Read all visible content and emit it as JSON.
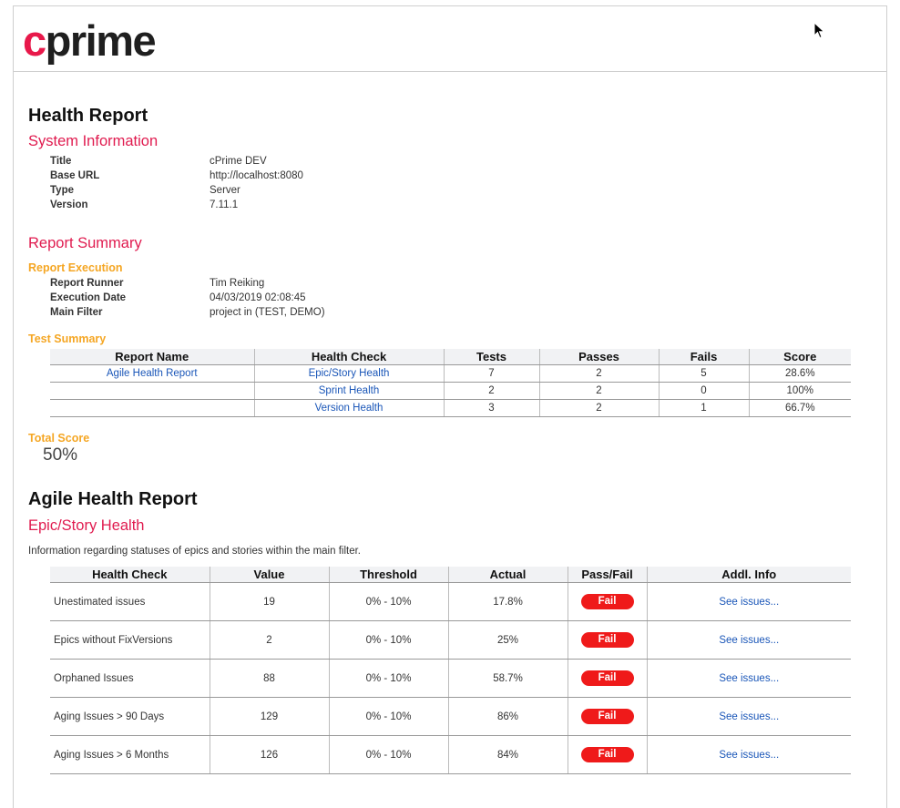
{
  "logo": {
    "first": "c",
    "rest": "prime"
  },
  "health_report_title": "Health Report",
  "system_info": {
    "heading": "System Information",
    "rows": [
      {
        "key": "Title",
        "value": "cPrime DEV"
      },
      {
        "key": "Base URL",
        "value": "http://localhost:8080"
      },
      {
        "key": "Type",
        "value": "Server"
      },
      {
        "key": "Version",
        "value": "7.11.1"
      }
    ]
  },
  "report_summary": {
    "heading": "Report Summary",
    "execution_heading": "Report Execution",
    "execution_rows": [
      {
        "key": "Report Runner",
        "value": "Tim Reiking"
      },
      {
        "key": "Execution Date",
        "value": "04/03/2019 02:08:45"
      },
      {
        "key": "Main Filter",
        "value": "project in (TEST, DEMO)"
      }
    ],
    "test_summary_heading": "Test Summary",
    "test_summary_columns": [
      "Report Name",
      "Health Check",
      "Tests",
      "Passes",
      "Fails",
      "Score"
    ],
    "test_summary_rows": [
      {
        "report_name": "Agile Health Report",
        "health_check": "Epic/Story Health",
        "tests": "7",
        "passes": "2",
        "fails": "5",
        "score": "28.6%"
      },
      {
        "report_name": "",
        "health_check": "Sprint Health",
        "tests": "2",
        "passes": "2",
        "fails": "0",
        "score": "100%"
      },
      {
        "report_name": "",
        "health_check": "Version Health",
        "tests": "3",
        "passes": "2",
        "fails": "1",
        "score": "66.7%"
      }
    ],
    "total_score_heading": "Total Score",
    "total_score_value": "50%"
  },
  "agile_report": {
    "title": "Agile Health Report",
    "section_heading": "Epic/Story Health",
    "description": "Information regarding statuses of epics and stories within the main filter.",
    "columns": [
      "Health Check",
      "Value",
      "Threshold",
      "Actual",
      "Pass/Fail",
      "Addl. Info"
    ],
    "rows": [
      {
        "check": "Unestimated issues",
        "value": "19",
        "threshold": "0% - 10%",
        "actual": "17.8%",
        "result": "Fail",
        "info": "See issues..."
      },
      {
        "check": "Epics without FixVersions",
        "value": "2",
        "threshold": "0% - 10%",
        "actual": "25%",
        "result": "Fail",
        "info": "See issues..."
      },
      {
        "check": "Orphaned Issues",
        "value": "88",
        "threshold": "0% - 10%",
        "actual": "58.7%",
        "result": "Fail",
        "info": "See issues..."
      },
      {
        "check": "Aging Issues > 90 Days",
        "value": "129",
        "threshold": "0% - 10%",
        "actual": "86%",
        "result": "Fail",
        "info": "See issues..."
      },
      {
        "check": "Aging Issues > 6 Months",
        "value": "126",
        "threshold": "0% - 10%",
        "actual": "84%",
        "result": "Fail",
        "info": "See issues..."
      }
    ]
  },
  "colors": {
    "brand": "#e8184a",
    "heading_red": "#e01b4f",
    "subheading_orange": "#f5a623",
    "fail_badge": "#ef1a1a",
    "link": "#1a56b8"
  }
}
